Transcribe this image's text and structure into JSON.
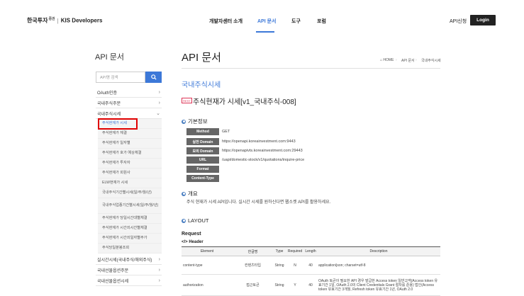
{
  "header": {
    "brand": "한국투자",
    "brand_sub": "증권",
    "brand_sep": "|",
    "site": "KIS Developers",
    "nav": [
      "개발자센터 소개",
      "API 문서",
      "도구",
      "포럼"
    ],
    "api_apply": "API신청",
    "login": "Login"
  },
  "sidebar": {
    "title": "API 문서",
    "search_placeholder": "API명 검색",
    "categories_top": [
      "OAuth인증",
      "국내주식주문",
      "국내주식시세"
    ],
    "subitems": [
      "주식현재가 시세",
      "주식현재가 체결",
      "주식현재가 일자별",
      "주식현재가 호가 예상체결",
      "주식현재가 투자자",
      "주식현재가 회원사",
      "ELW현재가 시세",
      "국내주식기간별시세(일/주/월/년)",
      "국내주식업종기간별시세(일/주/월/년)",
      "주식현재가 당일시간대별체결",
      "주식현재가 시간외시간별체결",
      "주식현재가 시간외일자별주가",
      "주식당일분봉조회"
    ],
    "categories_bottom": [
      "실시간시세(국내주식/해외주식)",
      "국내선물옵션주문",
      "국내선물옵션시세"
    ]
  },
  "main": {
    "page_title": "API 문서",
    "breadcrumb": [
      "HOME",
      "API 문서",
      "국내주식시세"
    ],
    "section_title": "국내주식시세",
    "badge": "REST",
    "api_name": "주식현재가 시세[v1_국내주식-008]",
    "basic_info_title": "기본정보",
    "basic_info": [
      {
        "label": "Method",
        "value": "GET"
      },
      {
        "label": "실전 Domain",
        "value": "https://openapi.koreainvestment.com:9443"
      },
      {
        "label": "모의 Domain",
        "value": "https://openapivts.koreainvestment.com:29443"
      },
      {
        "label": "URL",
        "value": "/uapi/domestic-stock/v1/quotations/inquire-price"
      },
      {
        "label": "Format",
        "value": ""
      },
      {
        "label": "Content-Type",
        "value": ""
      }
    ],
    "overview_title": "개요",
    "overview_text": "주식 현재가 시세 API입니다. 실시간 시세를 원하신다면 웹소켓 API를 활용하세요.",
    "layout_title": "LAYOUT",
    "request_label": "Request",
    "header_label": "</> Header",
    "table_headers": [
      "Element",
      "한글명",
      "Type",
      "Required",
      "Length",
      "Description"
    ],
    "table_rows": [
      {
        "element": "content-type",
        "name": "컨텐츠타입",
        "type": "String",
        "required": "N",
        "length": "40",
        "description": "application/json; charset=utf-8"
      },
      {
        "element": "authorization",
        "name": "접근토큰",
        "type": "String",
        "required": "Y",
        "length": "40",
        "description": "OAuth 토큰이 필요한 API 경우 발급한 Access token 일반고객(Access token 유효기간 1일, OAuth 2.0의 Client Credentials Grant 절차를 준용) 법인(Access token 유효기간 3개월, Refresh token 유효기간 1년, OAuth 2.0"
      }
    ]
  },
  "colors": {
    "accent": "#3c78d8",
    "highlight": "#e00000",
    "login_bg": "#222222"
  }
}
